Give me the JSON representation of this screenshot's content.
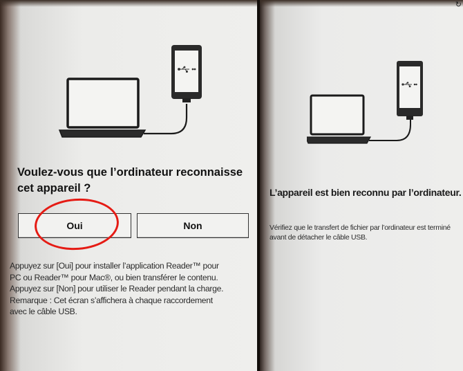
{
  "left_screen": {
    "question_line1": "Voulez-vous que l’ordinateur reconnaisse",
    "question_line2": "cet appareil ?",
    "yes_label": "Oui",
    "no_label": "Non",
    "help_lines": [
      "Appuyez sur [Oui] pour installer l’application Reader™ pour",
      "PC ou Reader™ pour Mac®, ou bien transférer le contenu.",
      "Appuyez sur [Non] pour utiliser le Reader pendant la charge.",
      "Remarque : Cet écran s’affichera à chaque raccordement",
      "avec le câble USB."
    ]
  },
  "right_screen": {
    "success_title": "L’appareil est bien reconnu par l’ordinateur.",
    "verify_text": "Vérifiez que le transfert de fichier par l’ordinateur est terminé avant de détacher le câble USB."
  },
  "icons": {
    "usb": "usb-icon",
    "status": "sync-status-icon"
  },
  "colors": {
    "annotation": "#e51b14",
    "text": "#111111",
    "screen_bg": "#eeeeec"
  }
}
